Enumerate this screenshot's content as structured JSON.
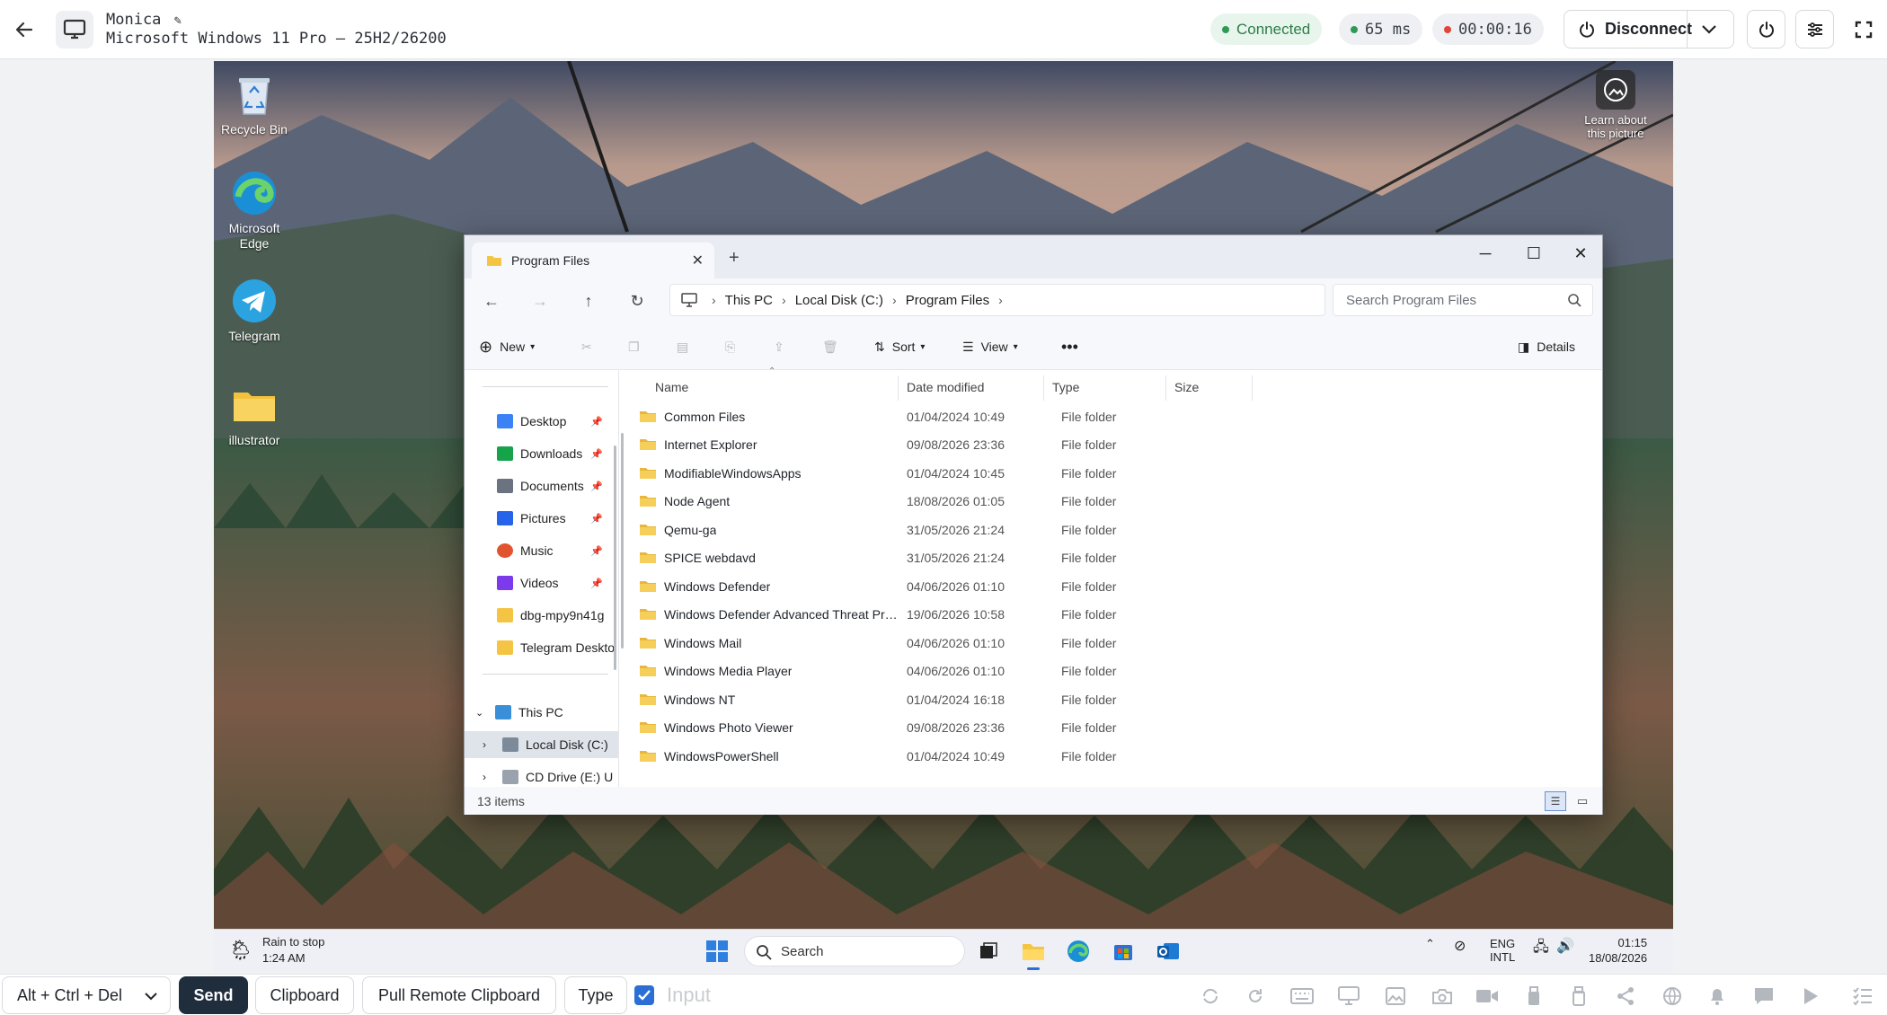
{
  "topbar": {
    "machine_name": "Monica",
    "os_label": "Microsoft Windows 11 Pro — 25H2/26200",
    "status": "Connected",
    "latency": "65 ms",
    "session_time": "00:00:16",
    "disconnect_label": "Disconnect"
  },
  "desktop": {
    "icons": [
      {
        "label": "Recycle Bin"
      },
      {
        "label": "Microsoft Edge"
      },
      {
        "label": "Telegram"
      },
      {
        "label": "illustrator"
      }
    ],
    "learn_label": "Learn about this picture"
  },
  "explorer": {
    "tab_title": "Program Files",
    "breadcrumbs": [
      "This PC",
      "Local Disk (C:)",
      "Program Files"
    ],
    "search_placeholder": "Search Program Files",
    "commands": {
      "new": "New",
      "sort": "Sort",
      "view": "View",
      "details": "Details"
    },
    "sidebar": [
      {
        "label": "Desktop",
        "pinned": true,
        "color": "#3b82f6"
      },
      {
        "label": "Downloads",
        "pinned": true,
        "color": "#16a34a"
      },
      {
        "label": "Documents",
        "pinned": true,
        "color": "#6b7280"
      },
      {
        "label": "Pictures",
        "pinned": true,
        "color": "#2563eb"
      },
      {
        "label": "Music",
        "pinned": true,
        "color": "#e0552f"
      },
      {
        "label": "Videos",
        "pinned": true,
        "color": "#7c3aed"
      },
      {
        "label": "dbg-mpy9n41g",
        "pinned": false,
        "color": "#f4c542"
      },
      {
        "label": "Telegram Deskto",
        "pinned": false,
        "color": "#f4c542"
      }
    ],
    "tree": [
      {
        "label": "This PC"
      },
      {
        "label": "Local Disk (C:)"
      },
      {
        "label": "CD Drive (E:) U"
      }
    ],
    "columns": [
      "Name",
      "Date modified",
      "Type",
      "Size"
    ],
    "rows": [
      {
        "name": "Common Files",
        "date": "01/04/2024 10:49",
        "type": "File folder"
      },
      {
        "name": "Internet Explorer",
        "date": "09/08/2026 23:36",
        "type": "File folder"
      },
      {
        "name": "ModifiableWindowsApps",
        "date": "01/04/2024 10:45",
        "type": "File folder"
      },
      {
        "name": "Node Agent",
        "date": "18/08/2026 01:05",
        "type": "File folder"
      },
      {
        "name": "Qemu-ga",
        "date": "31/05/2026 21:24",
        "type": "File folder"
      },
      {
        "name": "SPICE webdavd",
        "date": "31/05/2026 21:24",
        "type": "File folder"
      },
      {
        "name": "Windows Defender",
        "date": "04/06/2026 01:10",
        "type": "File folder"
      },
      {
        "name": "Windows Defender Advanced Threat Pro...",
        "date": "19/06/2026 10:58",
        "type": "File folder"
      },
      {
        "name": "Windows Mail",
        "date": "04/06/2026 01:10",
        "type": "File folder"
      },
      {
        "name": "Windows Media Player",
        "date": "04/06/2026 01:10",
        "type": "File folder"
      },
      {
        "name": "Windows NT",
        "date": "01/04/2024 16:18",
        "type": "File folder"
      },
      {
        "name": "Windows Photo Viewer",
        "date": "09/08/2026 23:36",
        "type": "File folder"
      },
      {
        "name": "WindowsPowerShell",
        "date": "01/04/2024 10:49",
        "type": "File folder"
      }
    ],
    "status": "13 items"
  },
  "taskbar": {
    "weather_title": "Rain to stop",
    "weather_time": "1:24 AM",
    "search_label": "Search",
    "lang": "ENG",
    "lang_sub": "INTL",
    "time": "01:15",
    "date": "18/08/2026"
  },
  "bottombar": {
    "keys_label": "Alt + Ctrl + Del",
    "send_label": "Send",
    "clipboard_label": "Clipboard",
    "pull_label": "Pull Remote Clipboard",
    "type_label": "Type",
    "input_placeholder": "Input"
  },
  "colors": {
    "accent": "#2b6ed4",
    "connected": "#2e7d4a",
    "record": "#e0453a",
    "folder": "#f4c542"
  }
}
